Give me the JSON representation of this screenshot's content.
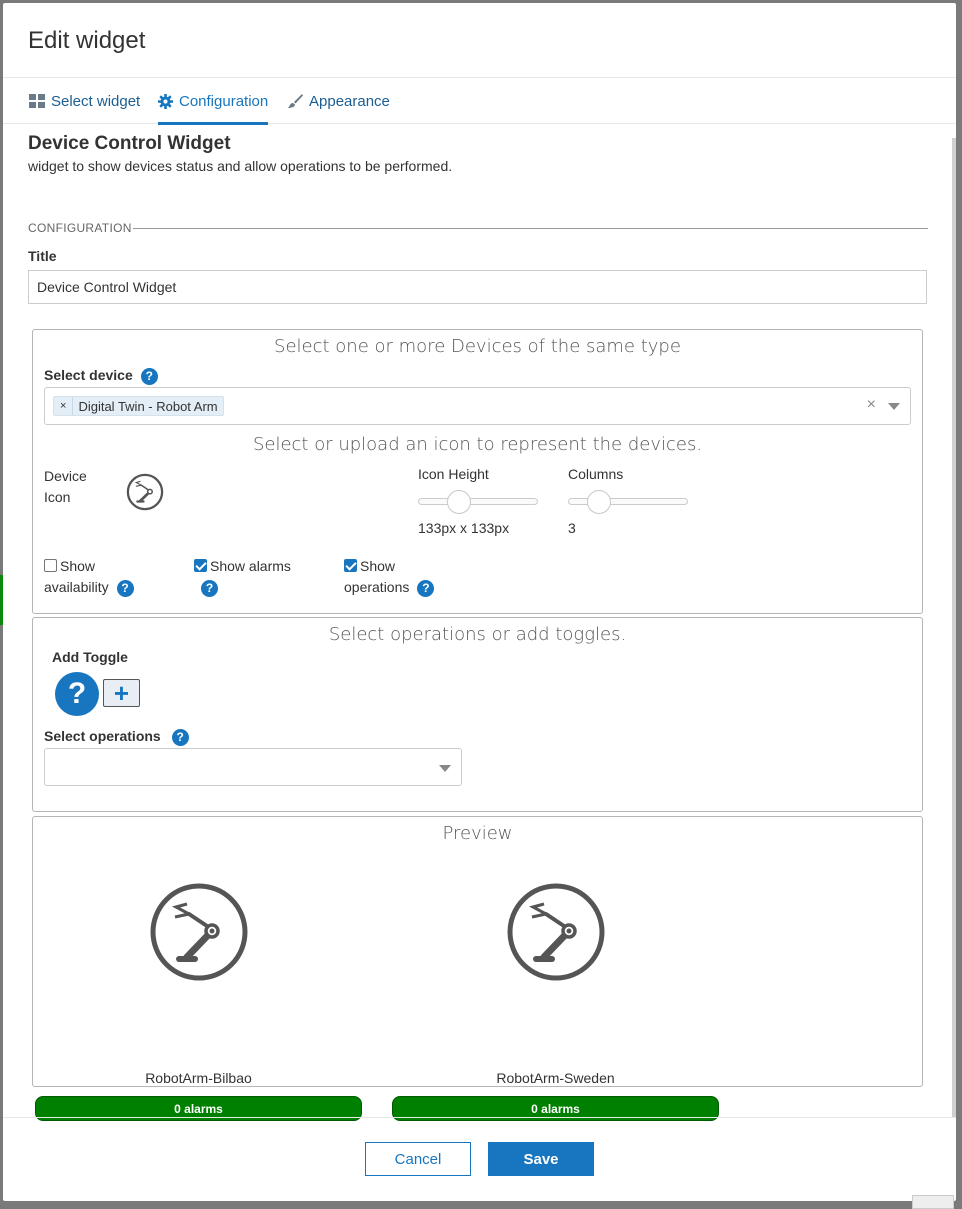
{
  "modal": {
    "title": "Edit widget"
  },
  "tabs": [
    {
      "label": "Select widget",
      "icon": "grid-icon"
    },
    {
      "label": "Configuration",
      "icon": "gear-icon"
    },
    {
      "label": "Appearance",
      "icon": "brush-icon"
    }
  ],
  "widget": {
    "name": "Device Control Widget",
    "description": "widget to show devices status and allow operations to be performed."
  },
  "configuration": {
    "section_label": "CONFIGURATION",
    "title_label": "Title",
    "title_value": "Device Control Widget"
  },
  "devices_panel": {
    "heading": "Select one or more Devices of the same type",
    "select_device_label": "Select device",
    "selected_chip": "Digital Twin - Robot Arm",
    "chip_remove": "×",
    "clear_all": "×",
    "icon_heading": "Select or upload an icon to represent the devices.",
    "device_icon_label_1": "Device",
    "device_icon_label_2": "Icon",
    "icon_height_label": "Icon Height",
    "icon_height_value": "133px x 133px",
    "icon_height_fraction": 0.3,
    "columns_label": "Columns",
    "columns_value": "3",
    "columns_fraction": 0.2,
    "show_availability_1": "Show",
    "show_availability_2": "availability",
    "show_availability_checked": false,
    "show_alarms": "Show alarms",
    "show_alarms_checked": true,
    "show_operations_1": "Show",
    "show_operations_2": "operations",
    "show_operations_checked": true
  },
  "operations_panel": {
    "heading": "Select operations or add toggles.",
    "add_toggle_label": "Add Toggle",
    "help_glyph": "?",
    "add_glyph": "+",
    "select_operations_label": "Select operations",
    "select_operations_value": ""
  },
  "preview": {
    "heading": "Preview",
    "devices": [
      {
        "name": "RobotArm-Bilbao",
        "status": "0 alarms"
      },
      {
        "name": "RobotArm-Sweden",
        "status": "0 alarms"
      }
    ]
  },
  "footer": {
    "cancel": "Cancel",
    "save": "Save"
  },
  "colors": {
    "primary": "#1776bf",
    "status_ok": "#008000"
  }
}
